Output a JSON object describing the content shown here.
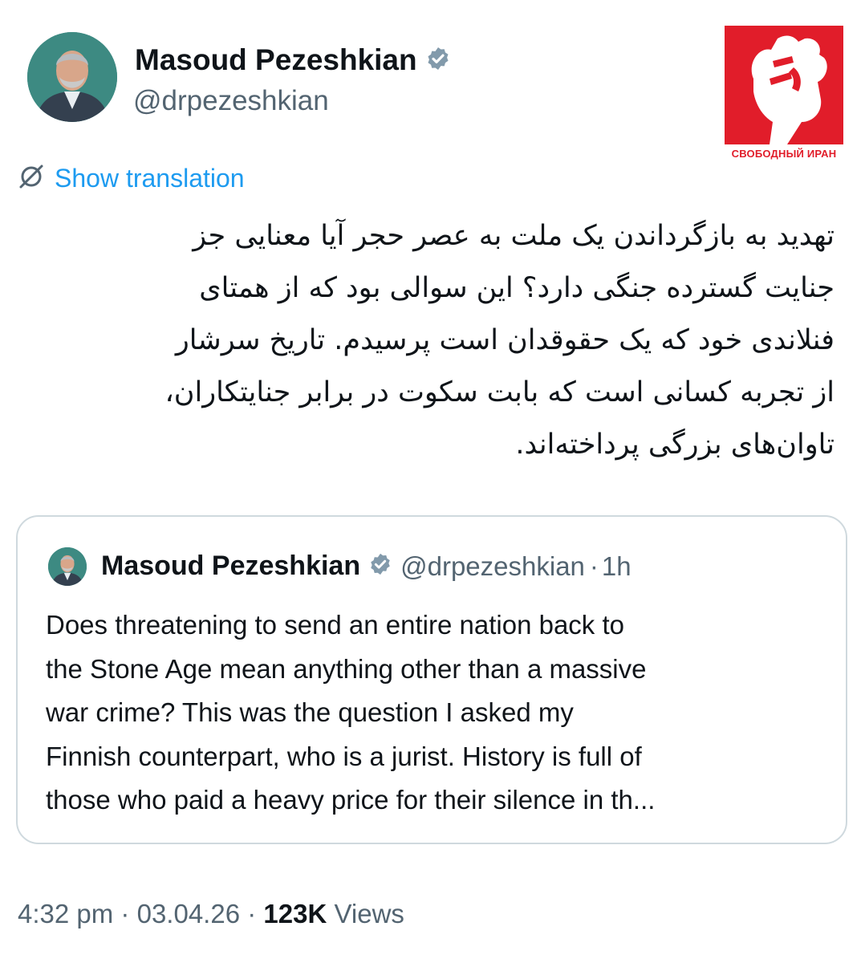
{
  "tweet": {
    "author_name": "Masoud Pezeshkian",
    "author_handle": "@drpezeshkian",
    "translate_label": "Show translation",
    "body_lines": [
      "تهدید به بازگرداندن یک ملت به عصر حجر آیا معنایی جز",
      "جنایت گسترده جنگی دارد؟ این سوالی بود که از همتای",
      "فنلاندی خود که یک حقوقدان است پرسیدم. تاریخ سرشار",
      "از تجربه کسانی است که بابت سکوت در برابر جنایتکاران،",
      "تاوان‌های بزرگی پرداخته‌اند."
    ],
    "time": "4:32 pm",
    "date": "03.04.26",
    "views_count": "123K",
    "views_label": "Views"
  },
  "quoted": {
    "author_name": "Masoud Pezeshkian",
    "author_handle": "@drpezeshkian",
    "age": "1h",
    "text_lines": [
      "Does threatening to send an entire nation back to",
      "the Stone Age mean anything other than a massive",
      "war crime? This was the question I asked my",
      "Finnish counterpart, who is a jurist. History is full of",
      "those who paid a heavy price for their silence in th..."
    ]
  },
  "watermark": {
    "caption": "СВОБОДНЫЙ ИРАН"
  },
  "colors": {
    "accent": "#1d9bf0",
    "secondary_text": "#536471",
    "brand_red": "#e11d2a",
    "border": "#cfd9de"
  },
  "icons": [
    "verified-badge-icon",
    "translate-icon",
    "raised-fist-icon"
  ]
}
